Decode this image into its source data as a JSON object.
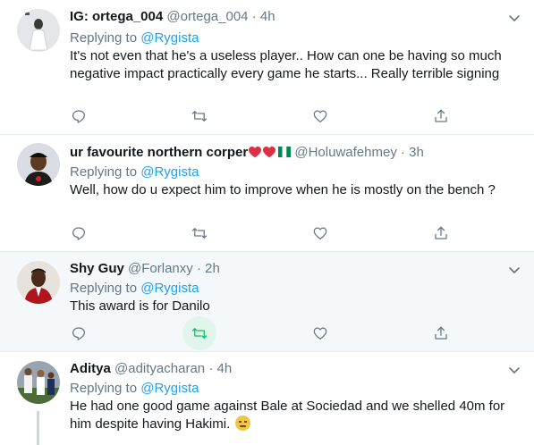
{
  "tweets": [
    {
      "display_name": "IG: ortega_004",
      "handle": "@ortega_004",
      "time": "4h",
      "replying_prefix": "Replying to",
      "replying_to": "@Rygista",
      "text": "It's not even that he's a useless player.. How can one be having so much negative impact practically every game he starts... Really terrible signing",
      "avatar_icon": "avatar-white-figure"
    },
    {
      "display_name": "ur favourite northern corper",
      "handle": "@Holuwafehmey",
      "time": "3h",
      "replying_prefix": "Replying to",
      "replying_to": "@Rygista",
      "text": "Well,  how do u expect him to improve when he is mostly on the bench ?",
      "avatar_icon": "avatar-person-cap",
      "name_emoji": [
        "red-heart-icon",
        "red-heart-icon",
        "nigeria-flag-icon"
      ]
    },
    {
      "display_name": "Shy Guy",
      "handle": "@Forlanxy",
      "time": "2h",
      "replying_prefix": "Replying to",
      "replying_to": "@Rygista",
      "text": "This award is for Danilo",
      "avatar_icon": "avatar-person-suit",
      "retweeted": true
    },
    {
      "display_name": "Aditya",
      "handle": "@adityacharan",
      "time": "4h",
      "replying_prefix": "Replying to",
      "replying_to": "@Rygista",
      "text": "He had one good game against Bale at Sociedad and we shelled 40m for him despite having Hakimi.",
      "avatar_icon": "avatar-football-players",
      "text_emoji": "expressionless-face-icon"
    }
  ],
  "separator": "·",
  "colors": {
    "text": "#14171a",
    "secondary": "#657786",
    "link": "#1da1f2",
    "retweet_active": "#17bf63",
    "divider": "#e6ecf0"
  }
}
